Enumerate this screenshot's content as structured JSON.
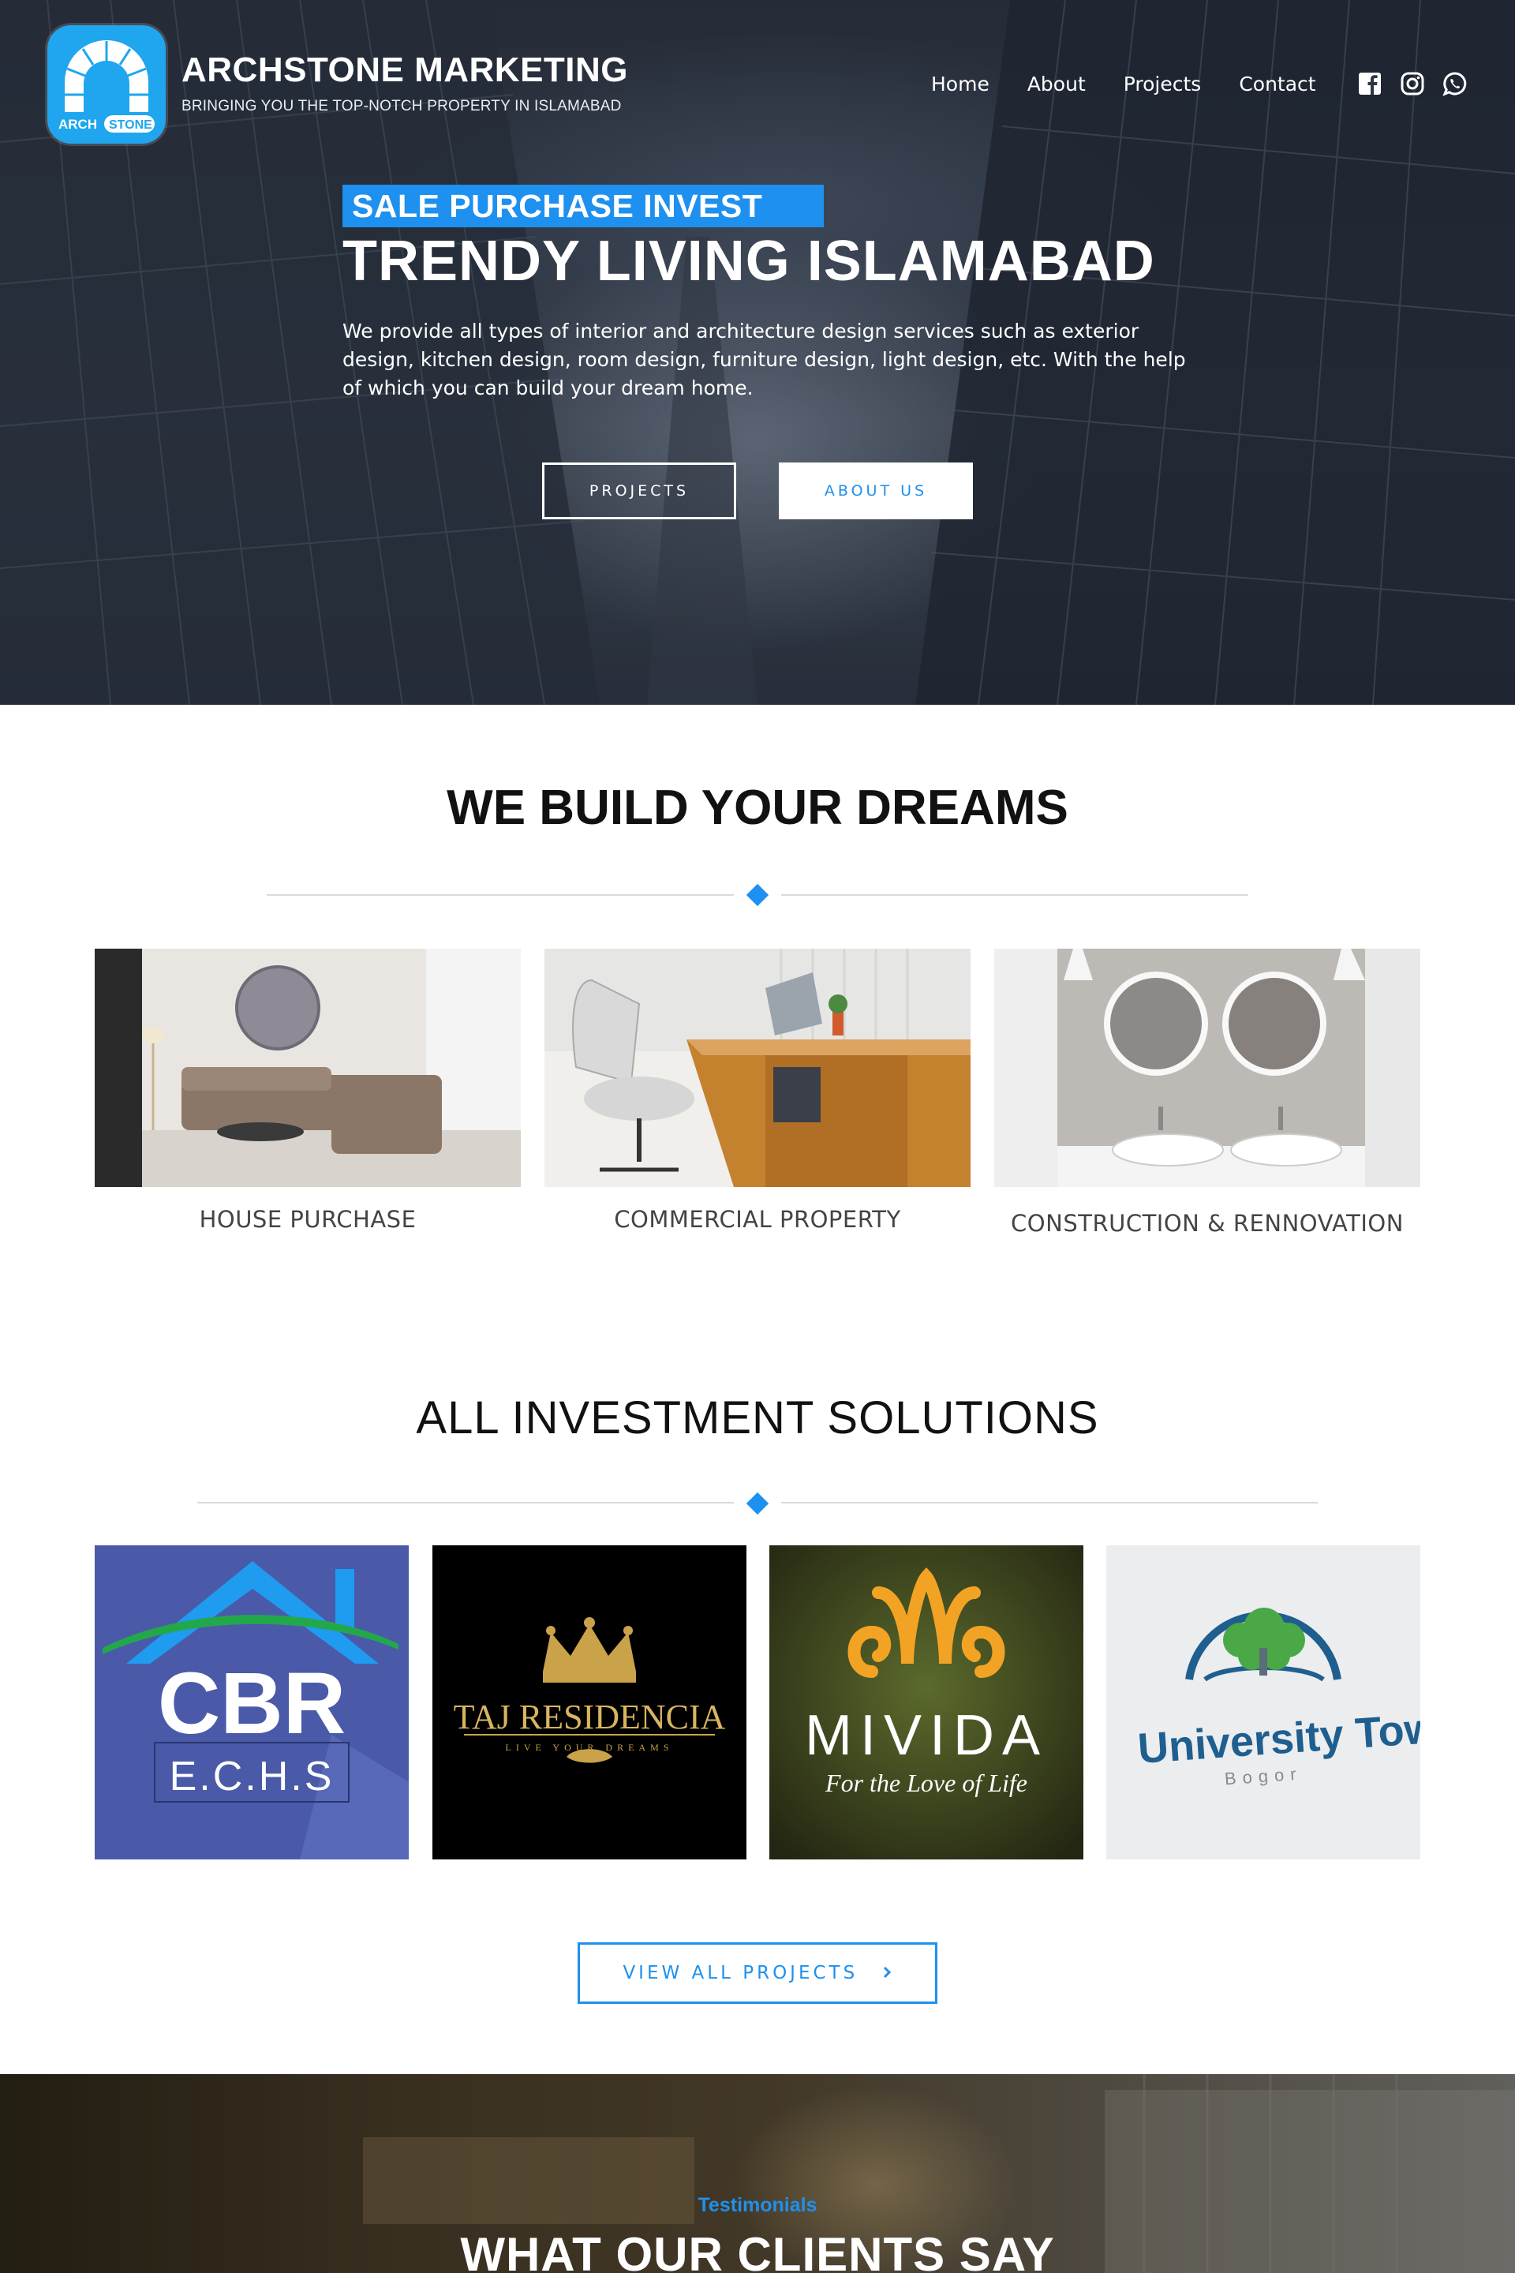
{
  "brand": {
    "title": "ARCHSTONE MARKETING",
    "tagline": "BRINGING YOU THE TOP-NOTCH PROPERTY IN ISLAMABAD",
    "logo_text_left": "ARCH",
    "logo_text_right": "STONE"
  },
  "nav": {
    "items": [
      {
        "label": "Home"
      },
      {
        "label": "About"
      },
      {
        "label": "Projects"
      },
      {
        "label": "Contact"
      }
    ],
    "social_icons": [
      "facebook-icon",
      "instagram-icon",
      "whatsapp-icon"
    ]
  },
  "hero": {
    "badge": "SALE PURCHASE INVEST",
    "title": "TRENDY LIVING ISLAMABAD",
    "description": "We provide all types of interior and architecture design services such as exterior design, kitchen design, room design, furniture design, light design, etc. With the help of which you can build your dream home.",
    "primary_button": "PROJECTS",
    "secondary_button": "ABOUT US"
  },
  "services": {
    "title": "WE BUILD YOUR DREAMS",
    "items": [
      {
        "label": "HOUSE PURCHASE",
        "image": "living-room-photo"
      },
      {
        "label": "COMMERCIAL PROPERTY",
        "image": "office-desk-photo"
      },
      {
        "label": "CONSTRUCTION & RENNOVATION",
        "image": "bathroom-photo"
      }
    ]
  },
  "investments": {
    "title": "ALL INVESTMENT SOLUTIONS",
    "projects": [
      {
        "name": "CBR",
        "sub": "E.C.H.S"
      },
      {
        "name": "TAJ RESIDENCIA",
        "sub": "LIVE YOUR DREAMS"
      },
      {
        "name": "MIVIDA",
        "sub": "For the Love of Life"
      },
      {
        "name": "University Town",
        "sub": "Bogor"
      }
    ],
    "view_all_button": "VIEW ALL PROJECTS",
    "view_all_icon": "chevron-right-icon"
  },
  "testimonials": {
    "kicker": "Testimonials",
    "title": "WHAT OUR CLIENTS SAY"
  },
  "colors": {
    "accent": "#1e90ef",
    "logo_bg": "#1fa6ef",
    "cbr_bg": "#4a5aa8",
    "taj_gold": "#c9a24a",
    "mivida_orange": "#f3a323"
  }
}
